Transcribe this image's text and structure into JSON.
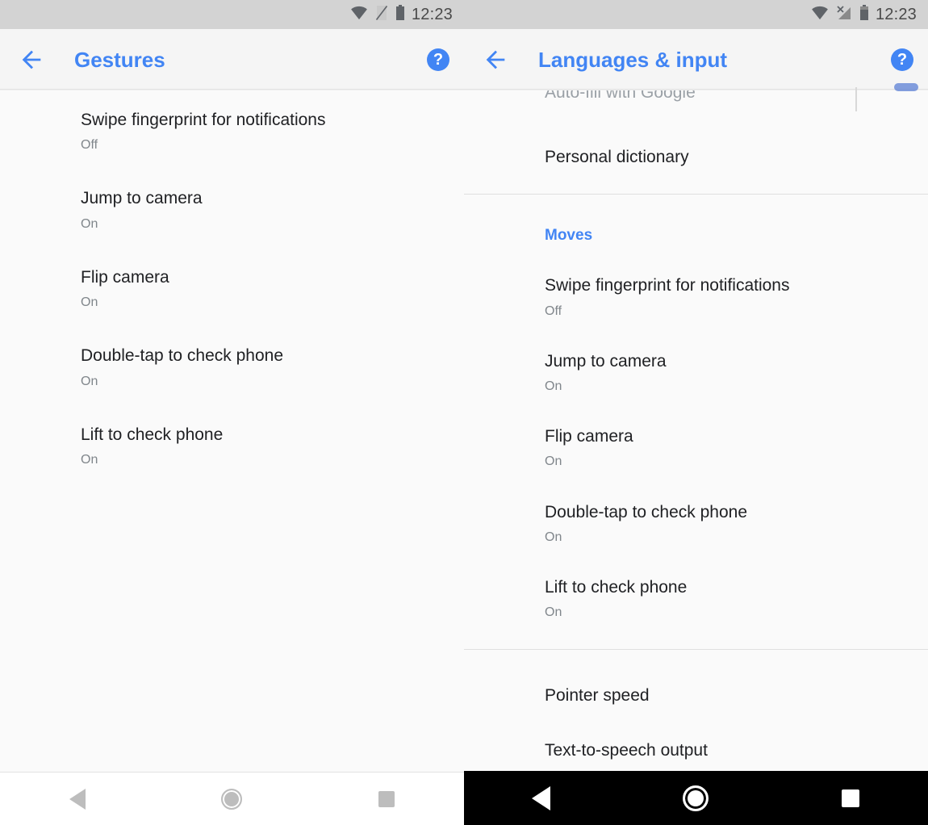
{
  "left_panel": {
    "statusbar": {
      "time": "12:23",
      "icons": [
        "wifi-icon",
        "no-sim-icon",
        "battery-icon"
      ]
    },
    "toolbar": {
      "back_label": "back-arrow-icon",
      "title": "Gestures",
      "help_label": "?"
    },
    "items": [
      {
        "title": "Swipe fingerprint for notifications",
        "state": "Off"
      },
      {
        "title": "Jump to camera",
        "state": "On"
      },
      {
        "title": "Flip camera",
        "state": "On"
      },
      {
        "title": "Double-tap to check phone",
        "state": "On"
      },
      {
        "title": "Lift to check phone",
        "state": "On"
      }
    ],
    "navbar": {
      "back": "back-triangle-icon",
      "home": "home-circle-icon",
      "recents": "recents-square-icon"
    }
  },
  "right_panel": {
    "statusbar": {
      "time": "12:23",
      "icons": [
        "wifi-icon",
        "no-signal-x-icon",
        "battery-icon"
      ]
    },
    "toolbar": {
      "back_label": "back-arrow-icon",
      "title": "Languages & input",
      "help_label": "?"
    },
    "clipped_item": {
      "title": "Auto-fill with Google"
    },
    "top_items": [
      {
        "title": "Personal dictionary"
      }
    ],
    "section": {
      "heading": "Moves"
    },
    "moves_items": [
      {
        "title": "Swipe fingerprint for notifications",
        "state": "Off"
      },
      {
        "title": "Jump to camera",
        "state": "On"
      },
      {
        "title": "Flip camera",
        "state": "On"
      },
      {
        "title": "Double-tap to check phone",
        "state": "On"
      },
      {
        "title": "Lift to check phone",
        "state": "On"
      }
    ],
    "bottom_items": [
      {
        "title": "Pointer speed"
      },
      {
        "title": "Text-to-speech output"
      }
    ],
    "navbar": {
      "back": "back-triangle-icon",
      "home": "home-circle-icon",
      "recents": "recents-square-icon"
    }
  },
  "colors": {
    "accent": "#4285f4",
    "title_text": "#202124",
    "secondary_text": "#80868b",
    "statusbar_bg": "#d3d3d3",
    "toolbar_bg": "#f5f5f5",
    "page_bg": "#fafafa"
  }
}
